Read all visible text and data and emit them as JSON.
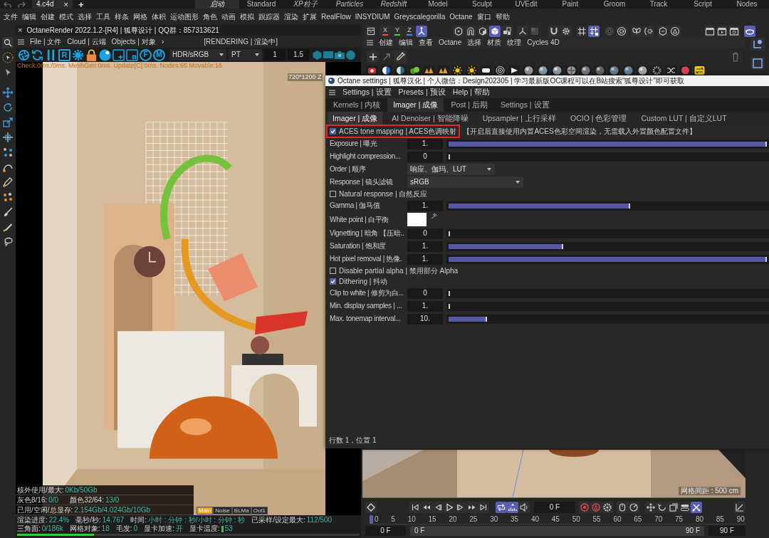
{
  "top_bar": {
    "file_tab": {
      "label": "4.c4d",
      "close": "×"
    },
    "new_tab": "+",
    "layouts": [
      {
        "label": "启动",
        "kind": "custom",
        "selected": true
      },
      {
        "label": "Standard",
        "kind": "builtin",
        "selected": false
      },
      {
        "label": "XP粒子",
        "kind": "custom",
        "selected": false
      },
      {
        "label": "Particles",
        "kind": "custom",
        "selected": false
      },
      {
        "label": "Redshift",
        "kind": "custom",
        "selected": false
      },
      {
        "label": "Model",
        "kind": "builtin",
        "selected": false
      },
      {
        "label": "Sculpt",
        "kind": "builtin",
        "selected": false
      },
      {
        "label": "UVEdit",
        "kind": "builtin",
        "selected": false
      },
      {
        "label": "Paint",
        "kind": "builtin",
        "selected": false
      },
      {
        "label": "Groom",
        "kind": "builtin",
        "selected": false
      },
      {
        "label": "Track",
        "kind": "builtin",
        "selected": false
      },
      {
        "label": "Script",
        "kind": "builtin",
        "selected": false
      },
      {
        "label": "Nodes",
        "kind": "builtin",
        "selected": false
      }
    ]
  },
  "menu_bar": [
    "文件",
    "编辑",
    "创建",
    "模式",
    "选择",
    "工具",
    "样条",
    "网格",
    "体积",
    "运动图形",
    "角色",
    "动画",
    "模拟",
    "跟踪器",
    "渲染",
    "扩展",
    "RealFlow",
    "INSYDIUM",
    "Greyscalegorilla",
    "Octane",
    "窗口",
    "帮助"
  ],
  "render_window": {
    "close": "×",
    "title": "OctaneRender 2022.1.2-[R4] | 狐尊设计 | QQ群：857313621",
    "menu": [
      "File | 文件",
      "Cloud | 云端",
      "Objects | 对象"
    ],
    "more": "›",
    "status": "[RENDERING | 渲染中]",
    "toolbar": {
      "letters": [
        "R",
        "F",
        "M"
      ],
      "display_mode": "HDR/sRGB",
      "kernel": "PT",
      "values": [
        "1",
        "1.5"
      ]
    },
    "stats_line": "Check:0ms./0ms. MeshGen:0ms. Update[C]:0ms. Nodes:65 Movable:16",
    "resolution": "720*1200 Z",
    "memory_info": [
      {
        "items": [
          {
            "label": "核外使用/最大:",
            "value": "0Kb/50Gb"
          }
        ]
      },
      {
        "items": [
          {
            "label": "灰色8/16:",
            "value": "0/0"
          },
          {
            "label": "颜色32/64:",
            "value": "13/0"
          }
        ]
      },
      {
        "items": [
          {
            "label": "已用/空闲/总显存:",
            "value": "2.154Gb/4.024Gb/10Gb"
          }
        ]
      }
    ],
    "passes": [
      {
        "label": "Main",
        "selected": true
      },
      {
        "label": "Noise",
        "selected": false
      },
      {
        "label": "BLMa",
        "selected": false
      },
      {
        "label": "Out1",
        "selected": false
      }
    ],
    "status_bar": [
      {
        "kind": "text",
        "label": "渲染进度:",
        "value": "22.4%"
      },
      {
        "kind": "text",
        "label": "毫秒/秒:",
        "value": "14.767"
      },
      {
        "kind": "text",
        "label": "时间:",
        "value": "小时 : 分钟 : 秒/小时 : 分钟 : 秒"
      },
      {
        "kind": "text",
        "label": "已采样/设定最大:",
        "value": "112/500"
      },
      {
        "kind": "text",
        "label": "三角面:",
        "value": "0/186k"
      },
      {
        "kind": "text",
        "label": "网格对象:",
        "value": "18"
      },
      {
        "kind": "text",
        "label": "毛发:",
        "value": "0"
      },
      {
        "kind": "text",
        "label": "显卡加速:",
        "value": "开"
      },
      {
        "kind": "gauge",
        "label": "显卡温度:",
        "value": "53"
      }
    ],
    "progress": {
      "level": 0.224
    }
  },
  "main_toolbar": {
    "axes": [
      {
        "label": "X",
        "color": "#e05656"
      },
      {
        "label": "Y",
        "color": "#5cb85c"
      },
      {
        "label": "Z",
        "color": "#4f86e0"
      }
    ],
    "buttons": [
      {
        "selected": false,
        "disabled": false
      },
      {
        "selected": true,
        "disabled": false
      },
      {
        "selected": false,
        "disabled": false
      },
      {
        "selected": false,
        "disabled": false
      },
      {
        "selected": false,
        "disabled": false
      },
      {
        "selected": true,
        "disabled": false
      },
      {
        "selected": false,
        "disabled": false
      },
      {
        "selected": false,
        "disabled": false
      },
      {
        "selected": false,
        "disabled": true
      },
      {
        "selected": false,
        "disabled": false
      },
      {
        "selected": false,
        "disabled": false
      },
      {
        "selected": false,
        "disabled": false
      },
      {
        "selected": true,
        "disabled": false
      },
      {
        "selected": false,
        "disabled": true
      },
      {
        "selected": false,
        "disabled": false
      },
      {
        "selected": false,
        "disabled": false
      },
      {
        "selected": false,
        "disabled": false
      },
      {
        "selected": false,
        "disabled": false
      },
      {
        "selected": false,
        "disabled": false
      },
      {
        "selected": false,
        "disabled": false
      },
      {
        "selected": false,
        "disabled": false
      },
      {
        "selected": false,
        "disabled": false
      },
      {
        "selected": true,
        "disabled": false
      }
    ]
  },
  "material_manager": {
    "menu": [
      "创建",
      "编辑",
      "查看",
      "Octane",
      "选择",
      "材质",
      "纹理",
      "Cycles 4D"
    ],
    "tools": [
      {
        "disabled": false
      },
      {
        "disabled": true
      },
      {
        "disabled": false
      },
      {
        "disabled": true
      }
    ]
  },
  "settings_dialog": {
    "title": "Octane settings | 狐尊汉化 | 个人微信：Design202305 | 学习最新版OC课程可以在B站搜索“狐尊设计”即可获取",
    "menu": [
      "Settings | 设置",
      "Presets | 预设",
      "Help | 帮助"
    ],
    "tabs": [
      {
        "label": "Kernels | 内核",
        "selected": false
      },
      {
        "label": "Imager | 成像",
        "selected": true
      },
      {
        "label": "Post | 后期",
        "selected": false
      },
      {
        "label": "Settings | 设置",
        "selected": false
      }
    ],
    "subtabs": [
      {
        "label": "Imager | 成像",
        "selected": true
      },
      {
        "label": "AI Denoiser | 智能降噪",
        "selected": false
      },
      {
        "label": "Upsampler | 上行采样",
        "selected": false
      },
      {
        "label": "OCIO | 色彩管理",
        "selected": false
      },
      {
        "label": "Custom LUT | 自定义LUT",
        "selected": false
      }
    ],
    "params": [
      {
        "kind": "checkbox",
        "label": "ACES tone mapping | ACES色调映射",
        "checked": true,
        "highlighted": true,
        "note": "【开启后直接使用内置ACES色彩空间渲染，无需载入外置颜色配置文件】"
      },
      {
        "kind": "slider",
        "label": "Exposure | 曝光",
        "value": "1.",
        "level": 1
      },
      {
        "kind": "slider",
        "label": "Highlight compression...",
        "value": "0",
        "level": 0
      },
      {
        "kind": "dropdown",
        "label": "Order | 顺序",
        "value": "响应、伽玛、LUT"
      },
      {
        "kind": "dropdown",
        "label": "Response | 镜头滤镜",
        "value": "sRGB"
      },
      {
        "kind": "checkbox",
        "label": "Natural response | 自然反应",
        "checked": false
      },
      {
        "kind": "slider",
        "label": "Gamma | 伽马值",
        "value": "1.",
        "level": 0.57
      },
      {
        "kind": "color",
        "label": "White point | 白平衡",
        "color": "#ffffff"
      },
      {
        "kind": "slider",
        "label": "Vignetting | 暗角 【压暗..",
        "value": "0",
        "level": 0
      },
      {
        "kind": "slider",
        "label": "Saturation | 饱和度",
        "value": "1.",
        "level": 0.36
      },
      {
        "kind": "slider",
        "label": "Hot pixel removal | 热像.",
        "value": "1.",
        "level": 1
      },
      {
        "kind": "checkbox",
        "label": "Disable partial alpha | 禁用部分 Alpha",
        "checked": false
      },
      {
        "kind": "checkbox",
        "label": "Dithering | 抖动",
        "checked": true
      },
      {
        "kind": "slider",
        "label": "Clip to white | 修剪为白...",
        "value": "0",
        "level": 0
      },
      {
        "kind": "slider",
        "label": "Min. display samples | ...",
        "value": "1.",
        "level": 0
      },
      {
        "kind": "slider",
        "label": "Max. tonemap interval...",
        "value": "10.",
        "level": 0.12
      }
    ],
    "status": "行数 1，位置 1"
  },
  "viewport": {
    "grid_spacing": "网格间距 : 500 cm"
  },
  "timeline": {
    "buttons": [
      {
        "selected": false
      },
      {
        "selected": false
      },
      {
        "selected": false
      },
      {
        "selected": false
      },
      {
        "selected": false
      },
      {
        "selected": false
      },
      {
        "selected": false
      },
      {
        "selected": false
      },
      {
        "selected": true
      },
      {
        "selected": true
      },
      {
        "selected": false
      },
      {
        "selected": false
      },
      {
        "selected": false
      },
      {
        "selected": false
      },
      {
        "selected": false
      },
      {
        "selected": false
      },
      {
        "selected": false
      },
      {
        "selected": false
      },
      {
        "selected": false
      },
      {
        "selected": false
      },
      {
        "selected": true
      },
      {
        "selected": false
      }
    ],
    "current_frame": "0 F",
    "ruler": [
      "0",
      "5",
      "10",
      "15",
      "20",
      "25",
      "30",
      "35",
      "40",
      "45",
      "50",
      "55",
      "60",
      "65",
      "70",
      "75",
      "80",
      "85",
      "90"
    ],
    "start_frame": "0 F",
    "range_start": "0 F",
    "range_end": "90 F",
    "end_frame": "90 F"
  }
}
